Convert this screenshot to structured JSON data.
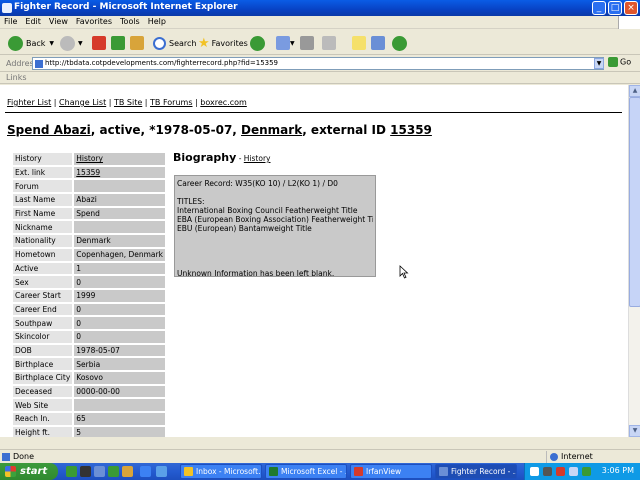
{
  "window": {
    "title": "Fighter Record - Microsoft Internet Explorer"
  },
  "menu": [
    "File",
    "Edit",
    "View",
    "Favorites",
    "Tools",
    "Help"
  ],
  "toolbar": {
    "back": "Back",
    "search": "Search",
    "favorites": "Favorites"
  },
  "address": {
    "label": "Address",
    "url": "http://tbdata.cotpdevelopments.com/fighterrecord.php?fid=15359",
    "go": "Go"
  },
  "links_label": "Links",
  "page": {
    "nav": [
      "Fighter List",
      "Change List",
      "TB Site",
      "TB Forums",
      "boxrec.com"
    ],
    "heading": {
      "name": "Spend Abazi",
      "status": ", active, *1978-05-07, ",
      "country": "Denmark",
      "ext_prefix": ", external ID ",
      "ext_id": "15359"
    },
    "info": [
      {
        "label": "History",
        "value": "History",
        "link": true
      },
      {
        "label": "Ext. link",
        "value": "15359",
        "link": true
      },
      {
        "label": "Forum",
        "value": ""
      },
      {
        "label": "Last Name",
        "value": "Abazi"
      },
      {
        "label": "First Name",
        "value": "Spend"
      },
      {
        "label": "Nickname",
        "value": ""
      },
      {
        "label": "Nationality",
        "value": "Denmark"
      },
      {
        "label": "Hometown",
        "value": "Copenhagen, Denmark"
      },
      {
        "label": "Active",
        "value": "1"
      },
      {
        "label": "Sex",
        "value": "0"
      },
      {
        "label": "Career Start",
        "value": "1999"
      },
      {
        "label": "Career End",
        "value": "0"
      },
      {
        "label": "Southpaw",
        "value": "0"
      },
      {
        "label": "Skincolor",
        "value": "0"
      },
      {
        "label": "DOB",
        "value": "1978-05-07"
      },
      {
        "label": "Birthplace",
        "value": "Serbia"
      },
      {
        "label": "Birthplace City",
        "value": "Kosovo"
      },
      {
        "label": "Deceased",
        "value": "0000-00-00"
      },
      {
        "label": "Web Site",
        "value": ""
      },
      {
        "label": "Reach In.",
        "value": "65"
      },
      {
        "label": "Height ft.",
        "value": "5"
      }
    ],
    "bio": {
      "title": "Biography",
      "sep": " - ",
      "history": "History",
      "lines": [
        "Career Record: W35(KO 10) / L2(KO 1) / D0",
        "",
        "TITLES:",
        "International Boxing Council Featherweight Title",
        "EBA (European Boxing Association) Featherweight Title",
        "EBU (European) Bantamweight Title",
        "",
        "",
        "",
        "",
        "Unknown Information has been left blank."
      ]
    }
  },
  "status": {
    "text": "Done",
    "zone": "Internet"
  },
  "taskbar": {
    "start": "start",
    "tasks": [
      "Inbox - Microsoft...",
      "Microsoft Excel - ...",
      "IrfanView",
      "Fighter Record - ..."
    ],
    "clock": "3:06 PM"
  },
  "colors": {
    "titlebar": "#0842c4",
    "taskbar": "#245bd0",
    "start": "#2f8a2f",
    "cell_label": "#e4e4e4",
    "cell_value": "#c9c9c9"
  }
}
